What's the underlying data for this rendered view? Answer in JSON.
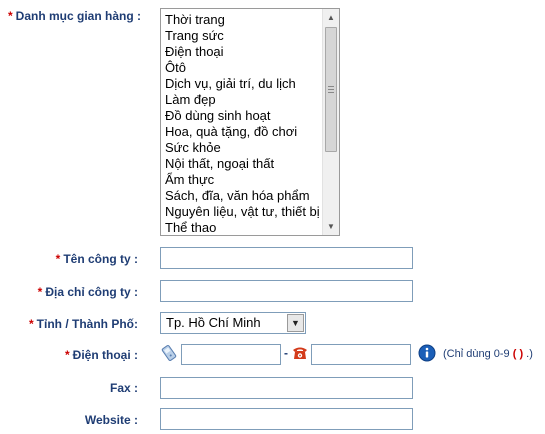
{
  "form": {
    "category": {
      "label": "Danh mục gian hàng :",
      "items": [
        "Thời trang",
        "Trang sức",
        "Điện thoại",
        "Ôtô",
        "Dịch vụ, giải trí, du lịch",
        "Làm đẹp",
        "Đồ dùng sinh hoạt",
        "Hoa, quà tặng, đồ chơi",
        "Sức khỏe",
        "Nội thất, ngoại thất",
        "Ẩm thực",
        "Sách, đĩa, văn hóa phẩm",
        "Nguyên liệu, vật tư, thiết bị",
        "Thể thao"
      ]
    },
    "company": {
      "label": "Tên công ty :",
      "value": ""
    },
    "address": {
      "label": "Địa chỉ công ty :",
      "value": ""
    },
    "province": {
      "label": "Tỉnh / Thành Phố:",
      "selected": "Tp. Hồ Chí Minh"
    },
    "phone": {
      "label": "Điện thoại :",
      "mobile_value": "",
      "landline_value": "",
      "separator": "-",
      "hint_prefix": "(Chỉ dùng 0-9",
      "hint_paren": "( )",
      "hint_suffix": ".)"
    },
    "fax": {
      "label": "Fax :",
      "value": ""
    },
    "website": {
      "label": "Website :",
      "value": ""
    },
    "required_mark": "*"
  },
  "colors": {
    "label": "#1f3d74",
    "required": "#cc0000",
    "input_border": "#7f9db9",
    "info_icon": "#1b5fb8",
    "phone_icon": "#d33a1a"
  }
}
